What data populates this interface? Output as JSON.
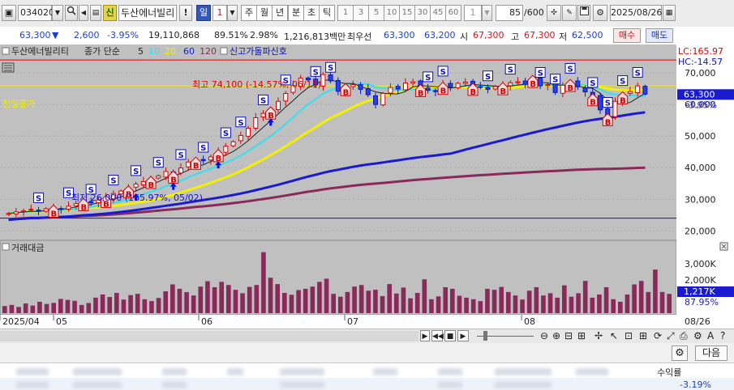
{
  "toolbar": {
    "code": "034020",
    "credit_badge": "신",
    "stock_name": "두산에너빌리",
    "alert_label": "!",
    "day_label": "일",
    "period_value": "1",
    "period_tabs": [
      "주",
      "월",
      "년",
      "분",
      "초",
      "틱"
    ],
    "minute_periods": [
      "1",
      "3",
      "5",
      "10",
      "15",
      "30",
      "45",
      "60",
      "1"
    ],
    "count_value": "85",
    "count_total": "/600",
    "date": "2025/08/26"
  },
  "quote": {
    "price": "63,300",
    "arrow": "▼",
    "change": "2,600",
    "change_pct": "-3.95%",
    "volume": "19,110,868",
    "vol_ratio": "89.51%",
    "turnover_pct": "2.98%",
    "amount": "1,216,813백만",
    "best_offer_label": "최우선",
    "ask": "63,300",
    "bid": "63,200",
    "open_label": "시",
    "open": "67,300",
    "high_label": "고",
    "high": "67,300",
    "low_label": "저",
    "low": "62,500",
    "buy_label": "매수",
    "sell_label": "매도"
  },
  "chart": {
    "legend_name": "두산에너빌리티",
    "legend_type": "종가 단순",
    "ma": [
      "5",
      "10",
      "20",
      "60",
      "120"
    ],
    "ma_colors": [
      "#222222",
      "#33e0f0",
      "#f5f000",
      "#1a1ad0",
      "#8a2a5a"
    ],
    "signal_label": "신고가돌파신호",
    "lc_label": "LC:165.97",
    "hc_label": "HC:-14.57",
    "high_annotation": "최고 74,100 (-14.57%, 06/11)",
    "low_annotation": "최저 26,000 (165.97%, 05/02)",
    "prev_vol_label": "전일종가",
    "current_price_tag": "63,300",
    "current_pct_tag": "-3.95%",
    "y_ticks": [
      "70,000",
      "60,000",
      "50,000",
      "40,000",
      "30,000",
      "20,000"
    ],
    "x_ticks": [
      "2025/04",
      "05",
      "06",
      "07",
      "08"
    ],
    "end_date": "08/26",
    "volume_title": "거래대금",
    "vol_ticks": [
      "3,000K",
      "2,000K",
      "1,000K"
    ],
    "vol_current": "1,217K",
    "vol_pct": "87.95%"
  },
  "chart_data": {
    "type": "candlestick",
    "ylim": [
      17000,
      79000
    ],
    "resistance_line": 74100,
    "support_line": 24000,
    "prev_close_line": 65900,
    "close": [
      25500,
      26000,
      26300,
      26800,
      26200,
      27000,
      27400,
      27000,
      27800,
      28600,
      29500,
      28900,
      29800,
      30500,
      31800,
      32600,
      33500,
      34800,
      35600,
      36500,
      37400,
      38800,
      38200,
      39900,
      41800,
      42600,
      42200,
      43400,
      45000,
      46800,
      48200,
      50200,
      52500,
      55800,
      57200,
      58500,
      61000,
      63500,
      66000,
      68400,
      67800,
      66200,
      69500,
      67500,
      64200,
      65900,
      66300,
      64800,
      63100,
      60000,
      63500,
      65400,
      64900,
      66800,
      67200,
      65600,
      64500,
      64100,
      66300,
      65500,
      66700,
      67100,
      66000,
      65500,
      64800,
      65700,
      66200,
      66900,
      67200,
      66400,
      68500,
      65900,
      66300,
      63800,
      66100,
      67200,
      65600,
      64000,
      62700,
      58300,
      56400,
      61000,
      63300,
      64100,
      65900,
      63300
    ],
    "volume_k": [
      450,
      520,
      390,
      610,
      480,
      720,
      580,
      650,
      900,
      840,
      780,
      520,
      640,
      980,
      1180,
      1020,
      1280,
      860,
      1140,
      1220,
      880,
      760,
      960,
      1380,
      1820,
      1540,
      1330,
      1120,
      1680,
      2020,
      1640,
      1980,
      1780,
      1480,
      1260,
      1660,
      1780,
      3860,
      2240,
      1840,
      1280,
      1160,
      1460,
      1540,
      1680,
      1980,
      2180,
      1220,
      1040,
      1340,
      1680,
      1780,
      1420,
      1480,
      1080,
      1840,
      1240,
      1620,
      940,
      1280,
      2140,
      880,
      1060,
      1640,
      1540,
      1100,
      980,
      880,
      760,
      1540,
      1480,
      1660,
      1340,
      1120,
      860,
      1420,
      1640,
      1120,
      1260,
      980,
      1760,
      1040,
      1260,
      2040,
      980,
      1180,
      1640,
      880,
      720,
      1180,
      1820,
      2040,
      1340,
      2760,
      1340,
      1217
    ]
  }
}
